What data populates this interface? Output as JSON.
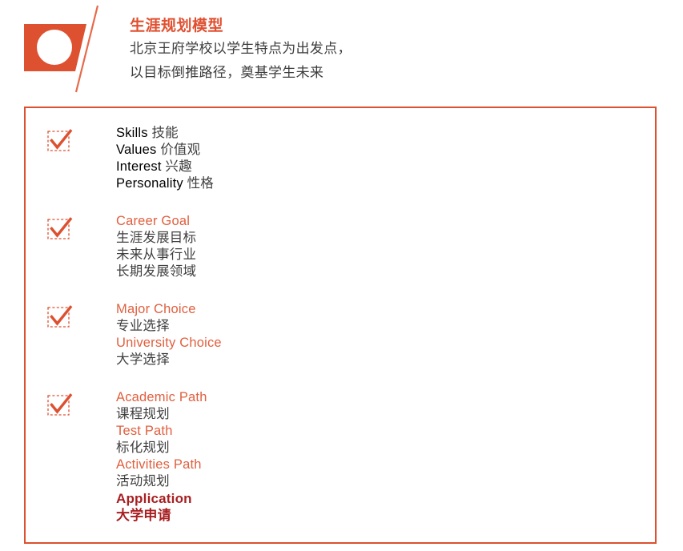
{
  "theme": {
    "accent": "#dd5030",
    "accent_text": "#e05f3e",
    "title_color": "#e05030",
    "body_gray": "#3f3f3f",
    "strong_red": "#a81f21",
    "panel_border": "#dd5030",
    "background": "#ffffff"
  },
  "header": {
    "logo_icon": "circle-in-parallelogram-logo",
    "slash_icon": "diagonal-slash-icon",
    "title": "生涯规划模型",
    "subtitle_lines": [
      "北京王府学校以学生特点为出发点，",
      "以目标倒推路径，奠基学生未来"
    ]
  },
  "panel": {
    "groups": [
      {
        "id": "self-assessment",
        "checkbox_icon": "checkmark-dashed-box-icon",
        "checked": true,
        "lines": [
          {
            "style": "mix",
            "en": "Skills",
            "zh": "技能"
          },
          {
            "style": "mix",
            "en": "Values",
            "zh": "价值观"
          },
          {
            "style": "mix",
            "en": "Interest",
            "zh": "兴趣"
          },
          {
            "style": "mix",
            "en": "Personality",
            "zh": "性格"
          }
        ]
      },
      {
        "id": "career-goal",
        "checkbox_icon": "checkmark-dashed-box-icon",
        "checked": true,
        "lines": [
          {
            "style": "en",
            "text": "Career Goal"
          },
          {
            "style": "zh",
            "text": "生涯发展目标"
          },
          {
            "style": "zh",
            "text": "未来从事行业"
          },
          {
            "style": "zh",
            "text": "长期发展领域"
          }
        ]
      },
      {
        "id": "major-university-choice",
        "checkbox_icon": "checkmark-dashed-box-icon",
        "checked": true,
        "lines": [
          {
            "style": "en",
            "text": "Major Choice"
          },
          {
            "style": "zh",
            "text": "专业选择"
          },
          {
            "style": "en",
            "text": "University Choice"
          },
          {
            "style": "zh",
            "text": "大学选择"
          }
        ]
      },
      {
        "id": "paths-application",
        "checkbox_icon": "checkmark-dashed-box-icon",
        "checked": true,
        "lines": [
          {
            "style": "en",
            "text": "Academic Path"
          },
          {
            "style": "zh",
            "text": "课程规划"
          },
          {
            "style": "en",
            "text": "Test Path"
          },
          {
            "style": "zh",
            "text": "标化规划"
          },
          {
            "style": "en",
            "text": "Activities Path"
          },
          {
            "style": "zh",
            "text": "活动规划"
          },
          {
            "style": "strong",
            "text": "Application"
          },
          {
            "style": "strong",
            "text": "大学申请"
          }
        ]
      }
    ]
  }
}
